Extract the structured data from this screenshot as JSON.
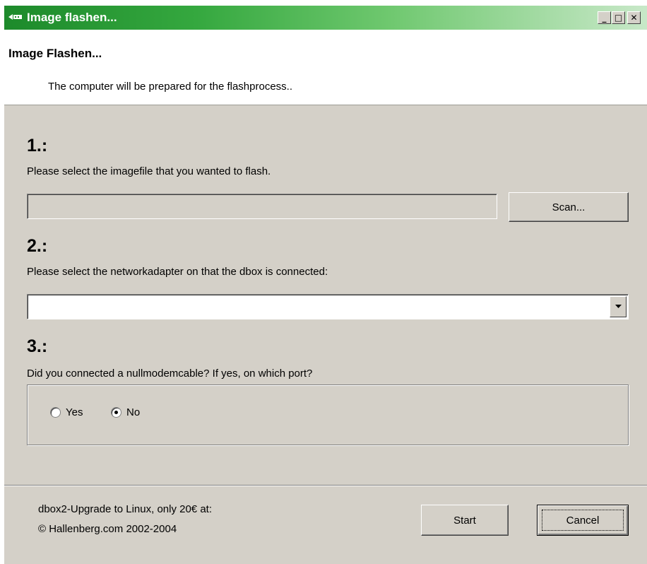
{
  "window": {
    "title": "Image flashen...",
    "controls": {
      "minimize": "_",
      "maximize": "□",
      "close": "✕"
    }
  },
  "header": {
    "title": "Image Flashen...",
    "subtitle": "The computer will be prepared for the flashprocess.."
  },
  "step1": {
    "number": "1.:",
    "text": "Please select the imagefile that you wanted to flash.",
    "path_value": "",
    "scan_label": "Scan..."
  },
  "step2": {
    "number": "2.:",
    "text": "Please select the networkadapter on that the dbox is connected:",
    "adapter_value": ""
  },
  "step3": {
    "number": "3.:",
    "text": "Did you connected a nullmodemcable? If yes, on which port?",
    "options": [
      {
        "label": "Yes",
        "selected": false
      },
      {
        "label": "No",
        "selected": true
      }
    ]
  },
  "footer": {
    "line1": "dbox2-Upgrade to Linux, only 20€ at:",
    "line2": "© Hallenberg.com 2002-2004",
    "start_label": "Start",
    "cancel_label": "Cancel"
  },
  "colors": {
    "titlebar": "#1d8a2b",
    "face": "#d4d0c8"
  }
}
